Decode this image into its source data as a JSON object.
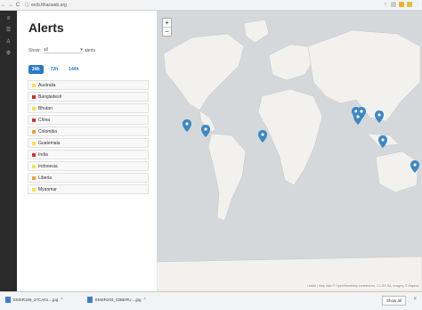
{
  "browser": {
    "url": "ercb.fthacweb.org",
    "back": "←",
    "forward": "→",
    "reload": "C"
  },
  "sidebar_strip": {
    "icons": [
      "menu-icon",
      "list-icon",
      "person-icon",
      "settings-icon"
    ]
  },
  "panel": {
    "title": "Alerts",
    "show_label": "Show:",
    "show_value": "all",
    "show_suffix": "alerts",
    "tabs": [
      {
        "label": "24h",
        "active": true
      },
      {
        "label": "72h",
        "active": false
      },
      {
        "label": "144h",
        "active": false
      }
    ],
    "alerts": [
      {
        "country": "Australia",
        "level_color": "#f5e44a"
      },
      {
        "country": "Bangladesh",
        "level_color": "#d32f2f"
      },
      {
        "country": "Bhutan",
        "level_color": "#f5e44a"
      },
      {
        "country": "China",
        "level_color": "#d32f2f"
      },
      {
        "country": "Colombia",
        "level_color": "#f0a030"
      },
      {
        "country": "Guatemala",
        "level_color": "#f5e44a"
      },
      {
        "country": "India",
        "level_color": "#d32f2f"
      },
      {
        "country": "Indonesia",
        "level_color": "#f5e44a"
      },
      {
        "country": "Liberia",
        "level_color": "#f0a030"
      },
      {
        "country": "Myanmar",
        "level_color": "#f5e44a"
      }
    ]
  },
  "map": {
    "zoom_in": "+",
    "zoom_out": "−",
    "attribution": "Leaflet | Map data © OpenStreetMap contributors, CC-BY-SA, Imagery © Mapbox",
    "marker_color": "#3c88c4"
  },
  "downloads": {
    "items": [
      {
        "name": "EMSR166_27CA01....jpg"
      },
      {
        "name": "EMSR203_02BERU....jpg"
      }
    ],
    "show_all": "Show all",
    "close": "×"
  }
}
